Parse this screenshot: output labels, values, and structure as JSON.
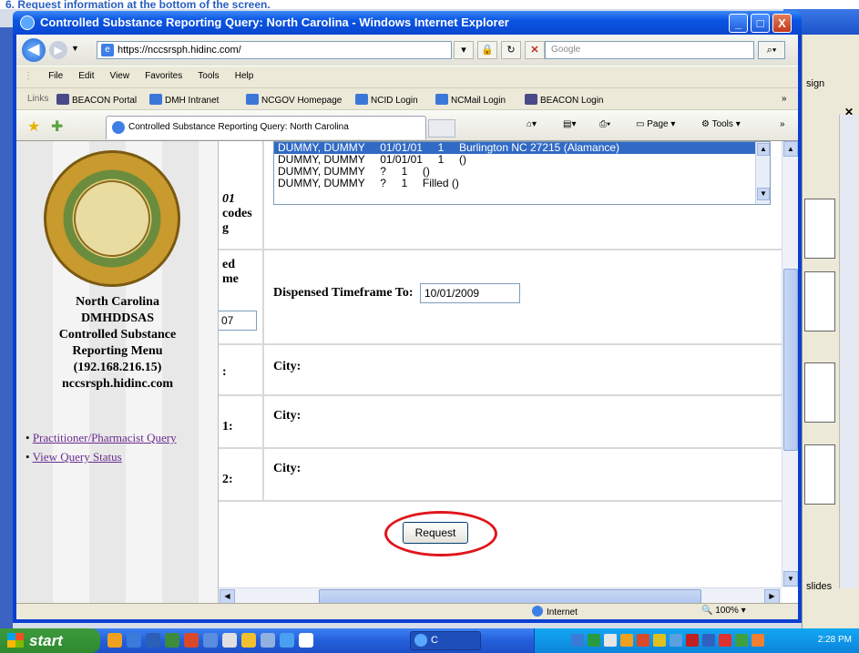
{
  "doc_header": "6. Request information at the bottom of the screen.",
  "window": {
    "title": "Controlled Substance Reporting Query: North Carolina - Windows Internet Explorer",
    "minimize": "_",
    "maximize": "□",
    "close": "X"
  },
  "background_window": {
    "sign_text": "sign",
    "slides_text": "slides"
  },
  "address_bar": {
    "url": "https://nccsrsph.hidinc.com/",
    "search_placeholder": "Google"
  },
  "menu": [
    "File",
    "Edit",
    "View",
    "Favorites",
    "Tools",
    "Help"
  ],
  "links": {
    "label": "Links",
    "items": [
      "BEACON Portal",
      "DMH Intranet",
      "NCGOV Homepage",
      "NCID Login",
      "NCMail Login",
      "BEACON Login"
    ]
  },
  "tab": {
    "title": "Controlled Substance Reporting Query: North Carolina"
  },
  "command_bar": {
    "page": "Page",
    "tools": "Tools"
  },
  "left_nav": {
    "title_lines": [
      "North Carolina",
      "DMHDDSAS",
      "Controlled Substance",
      "Reporting Menu",
      "(192.168.216.15)",
      "nccsrsph.hidinc.com"
    ],
    "links": [
      "Practitioner/Pharmacist Query",
      "View Query Status"
    ]
  },
  "form": {
    "row1_label_lines": [
      "01",
      "codes",
      "g"
    ],
    "patient_list": [
      {
        "text": "DUMMY, DUMMY     01/01/01     1     Burlington NC 27215 (Alamance)",
        "selected": true
      },
      {
        "text": "DUMMY, DUMMY     01/01/01     1     ()",
        "selected": false
      },
      {
        "text": "DUMMY, DUMMY     ?     1     ()",
        "selected": false
      },
      {
        "text": "DUMMY, DUMMY     ?     1     Filled ()",
        "selected": false
      }
    ],
    "row2_label_lines": [
      "ed",
      "me"
    ],
    "row2_partial_value": "07",
    "dispensed_to_label": "Dispensed Timeframe To:",
    "dispensed_to_value": "10/01/2009",
    "row3_label": ":",
    "row4_label": "1:",
    "row5_label": "2:",
    "city_label": "City:",
    "request_label": "Request"
  },
  "status_bar": {
    "zone": "Internet",
    "zoom": "100%"
  },
  "taskbar": {
    "start_label": "start",
    "app_label": "C",
    "clock": "2:28 PM"
  },
  "colors": {
    "title_bar": "#0a54e3",
    "selection": "#316ac5",
    "highlight_ring": "#e0161c",
    "visited_link": "#6a2c8f"
  }
}
